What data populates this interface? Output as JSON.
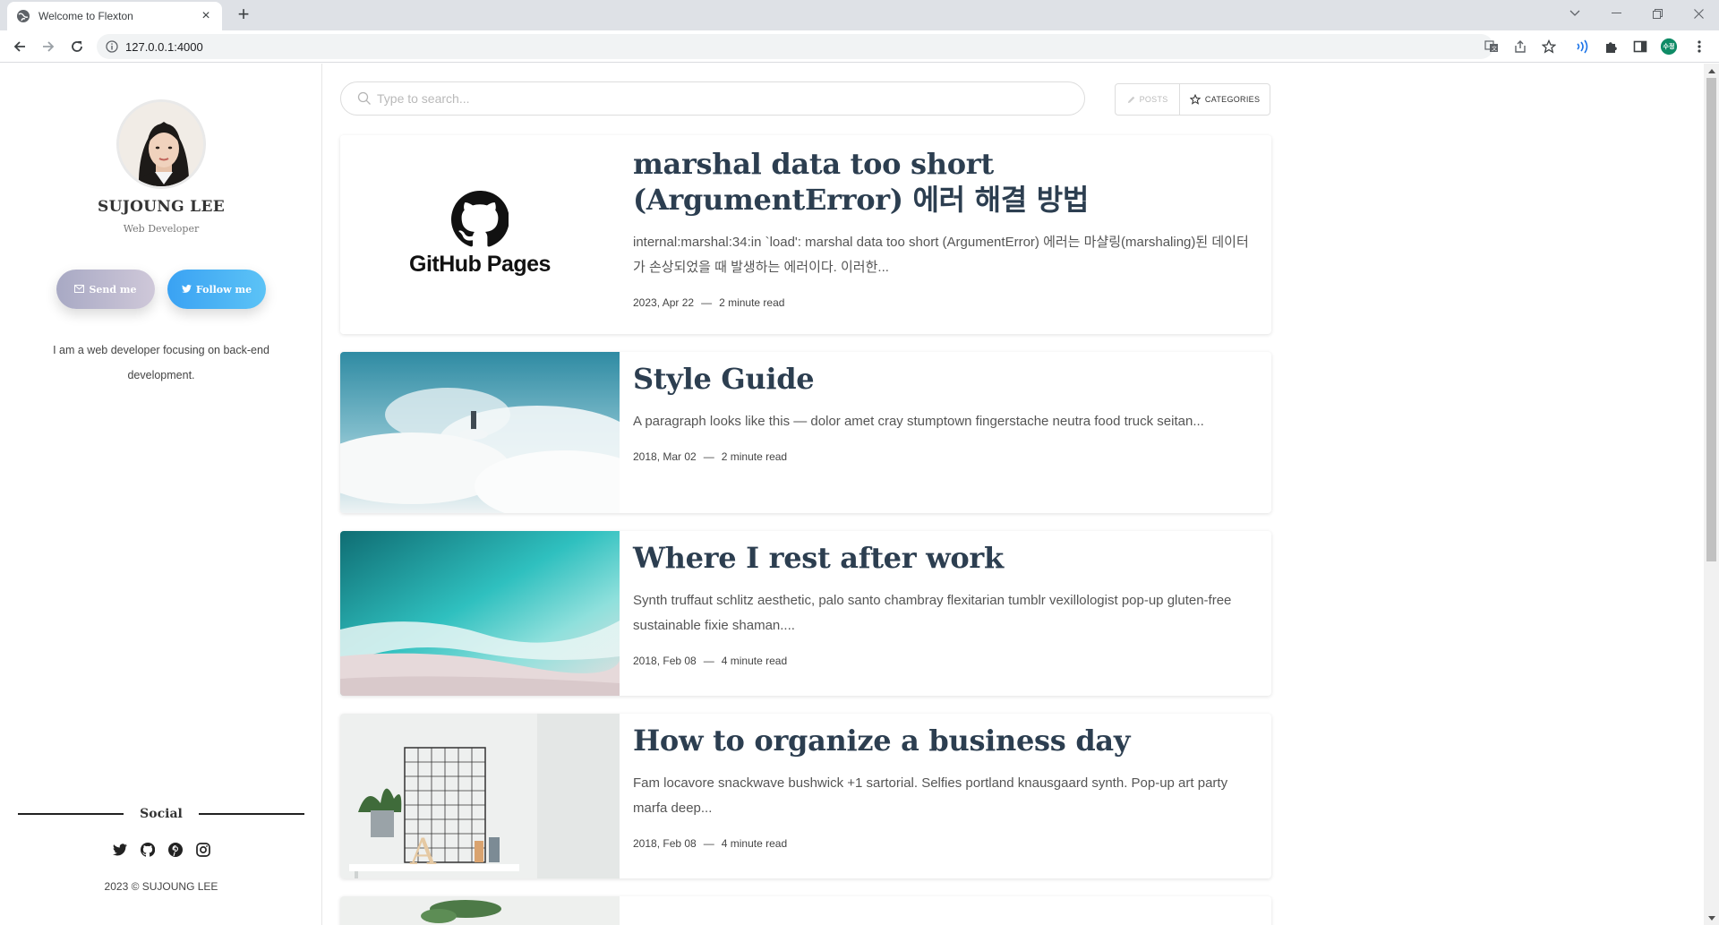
{
  "browser": {
    "tab_title": "Welcome to Flexton",
    "new_tab": "+",
    "tab_close": "×",
    "url": "127.0.0.1:4000",
    "profile_initial": "수정"
  },
  "profile": {
    "name": "SUJOUNG LEE",
    "role": "Web Developer",
    "send_label": "Send me",
    "follow_label": "Follow me",
    "bio": "I am a web developer focusing on back-end development."
  },
  "social": {
    "title": "Social",
    "icons": [
      "twitter-icon",
      "github-icon",
      "pinterest-icon",
      "instagram-icon"
    ],
    "copyright": "2023 © SUJOUNG LEE"
  },
  "search": {
    "placeholder": "Type to search..."
  },
  "toggles": {
    "posts_label": "POSTS",
    "categories_label": "CATEGORIES"
  },
  "posts": [
    {
      "title": "marshal data too short (ArgumentError) 에러 해결 방법",
      "excerpt": "internal:marshal:34:in `load': marshal data too short (ArgumentError) 에러는 마샬링(marshaling)된 데이터가 손상되었을 때 발생하는 에러이다. 이러한...",
      "date": "2023, Apr 22",
      "read": "2 minute read",
      "thumb_text": "GitHub Pages"
    },
    {
      "title": "Style Guide",
      "excerpt": "A paragraph looks like this — dolor amet cray stumptown fingerstache neutra food truck seitan...",
      "date": "2018, Mar 02",
      "read": "2 minute read"
    },
    {
      "title": "Where I rest after work",
      "excerpt": "Synth truffaut schlitz aesthetic, palo santo chambray flexitarian tumblr vexillologist pop-up gluten-free sustainable fixie shaman....",
      "date": "2018, Feb 08",
      "read": "4 minute read"
    },
    {
      "title": "How to organize a business day",
      "excerpt": "Fam locavore snackwave bushwick +1 sartorial. Selfies portland knausgaard synth. Pop-up art party marfa deep...",
      "date": "2018, Feb 08",
      "read": "4 minute read"
    }
  ],
  "colors": {
    "title": "#2c3e50",
    "follow_button": "#3aa2f3",
    "send_button": "#a8a9c4"
  }
}
